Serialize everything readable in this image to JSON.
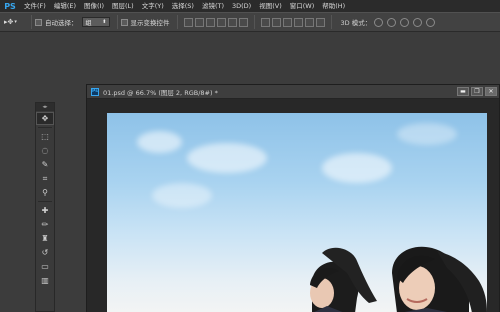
{
  "app": {
    "logo": "PS"
  },
  "menu": [
    "文件(F)",
    "编辑(E)",
    "图像(I)",
    "图层(L)",
    "文字(Y)",
    "选择(S)",
    "滤镜(T)",
    "3D(D)",
    "视图(V)",
    "窗口(W)",
    "帮助(H)"
  ],
  "options": {
    "auto_select_label": "自动选择：",
    "auto_select_value": "组",
    "show_transform_label": "显示变换控件",
    "threed_mode_label": "3D 模式："
  },
  "document": {
    "badge": "Ps",
    "title": "01.psd @ 66.7% (图层 2, RGB/8#) *",
    "minimize": "▬",
    "restore": "❐",
    "close": "✕"
  },
  "tools": [
    {
      "name": "move-tool",
      "glyph": "✥"
    },
    {
      "name": "marquee-tool",
      "glyph": "⬚"
    },
    {
      "name": "lasso-tool",
      "glyph": "◌"
    },
    {
      "name": "quick-selection-tool",
      "glyph": "✎"
    },
    {
      "name": "crop-tool",
      "glyph": "⌗"
    },
    {
      "name": "eyedropper-tool",
      "glyph": "⚲"
    },
    {
      "name": "healing-brush-tool",
      "glyph": "✚"
    },
    {
      "name": "brush-tool",
      "glyph": "✏"
    },
    {
      "name": "clone-stamp-tool",
      "glyph": "♜"
    },
    {
      "name": "history-brush-tool",
      "glyph": "↺"
    },
    {
      "name": "eraser-tool",
      "glyph": "▭"
    },
    {
      "name": "gradient-tool",
      "glyph": "▥"
    }
  ]
}
